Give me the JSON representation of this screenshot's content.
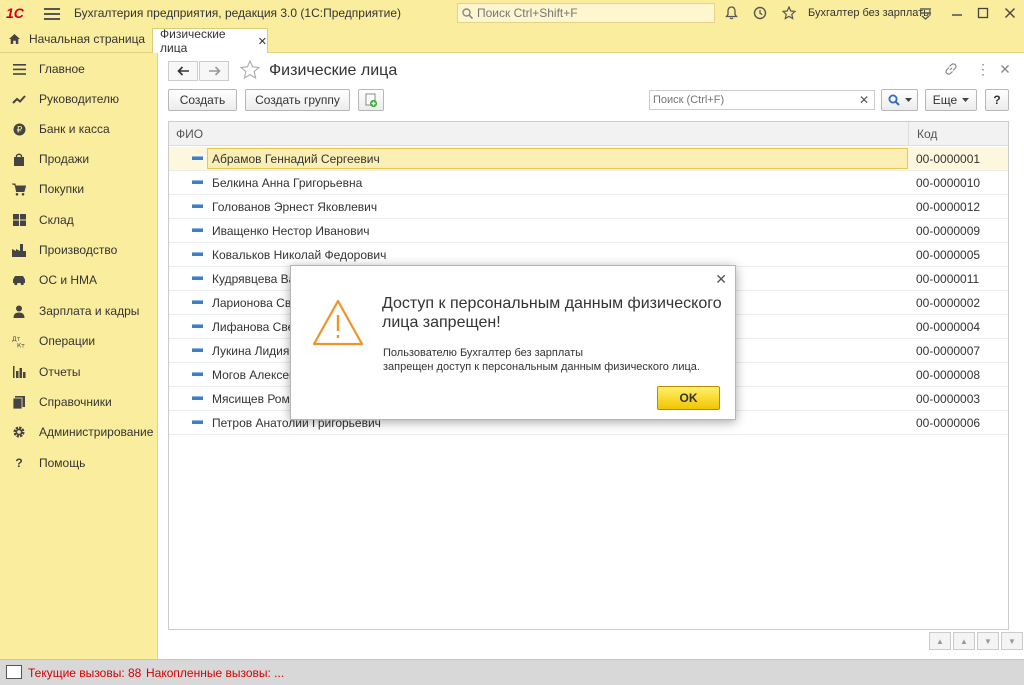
{
  "window": {
    "logo": "1С",
    "app_title": "Бухгалтерия предприятия, редакция 3.0  (1С:Предприятие)",
    "search_placeholder": "Поиск Ctrl+Shift+F",
    "user": "Бухгалтер без зарплаты"
  },
  "tabs": {
    "home": "Начальная страница",
    "active": "Физические лица",
    "close": "✕"
  },
  "sidebar": {
    "items": [
      {
        "label": "Главное",
        "icon": "menu-icon"
      },
      {
        "label": "Руководителю",
        "icon": "trend-icon"
      },
      {
        "label": "Банк и касса",
        "icon": "ruble-icon"
      },
      {
        "label": "Продажи",
        "icon": "bag-icon"
      },
      {
        "label": "Покупки",
        "icon": "cart-icon"
      },
      {
        "label": "Склад",
        "icon": "grid-icon"
      },
      {
        "label": "Производство",
        "icon": "factory-icon"
      },
      {
        "label": "ОС и НМА",
        "icon": "car-icon"
      },
      {
        "label": "Зарплата и кадры",
        "icon": "person-icon"
      },
      {
        "label": "Операции",
        "icon": "dtkt-icon"
      },
      {
        "label": "Отчеты",
        "icon": "bar-chart-icon"
      },
      {
        "label": "Справочники",
        "icon": "book-icon"
      },
      {
        "label": "Администрирование",
        "icon": "gear-icon"
      },
      {
        "label": "Помощь",
        "icon": "question-icon"
      }
    ]
  },
  "form": {
    "title": "Физические лица",
    "create": "Создать",
    "create_group": "Создать группу",
    "search_placeholder": "Поиск (Ctrl+F)",
    "more": "Еще",
    "help": "?"
  },
  "table": {
    "columns": [
      "ФИО",
      "Код"
    ],
    "rows": [
      {
        "name": "Абрамов Геннадий Сергеевич",
        "code": "00-0000001"
      },
      {
        "name": "Белкина Анна Григорьевна",
        "code": "00-0000010"
      },
      {
        "name": "Голованов Эрнест Яковлевич",
        "code": "00-0000012"
      },
      {
        "name": "Иващенко Нестор Иванович",
        "code": "00-0000009"
      },
      {
        "name": "Ковальков Николай Федорович",
        "code": "00-0000005"
      },
      {
        "name": "Кудрявцева Ва",
        "code": "00-0000011"
      },
      {
        "name": "Ларионова Све",
        "code": "00-0000002"
      },
      {
        "name": "Лифанова Све",
        "code": "00-0000004"
      },
      {
        "name": "Лукина Лидия I",
        "code": "00-0000007"
      },
      {
        "name": "Могов Алексей",
        "code": "00-0000008"
      },
      {
        "name": "Мясищев Рома",
        "code": "00-0000003"
      },
      {
        "name": "Петров Анатолий Григорьевич",
        "code": "00-0000006"
      }
    ]
  },
  "status": {
    "current_calls": "Текущие вызовы: 88",
    "accumulated_calls": "Накопленные вызовы: ..."
  },
  "dialog": {
    "title": "Доступ к персональным данным физического лица запрещен!",
    "line1": "Пользователю Бухгалтер без зарплаты",
    "line2": "запрещен доступ к персональным данным физического лица.",
    "ok": "OK",
    "close": "✕"
  },
  "colors": {
    "panel": "#fbed9e",
    "ok_button": "#f1c600",
    "warning": "#f0932b",
    "status_red": "#d50000"
  }
}
